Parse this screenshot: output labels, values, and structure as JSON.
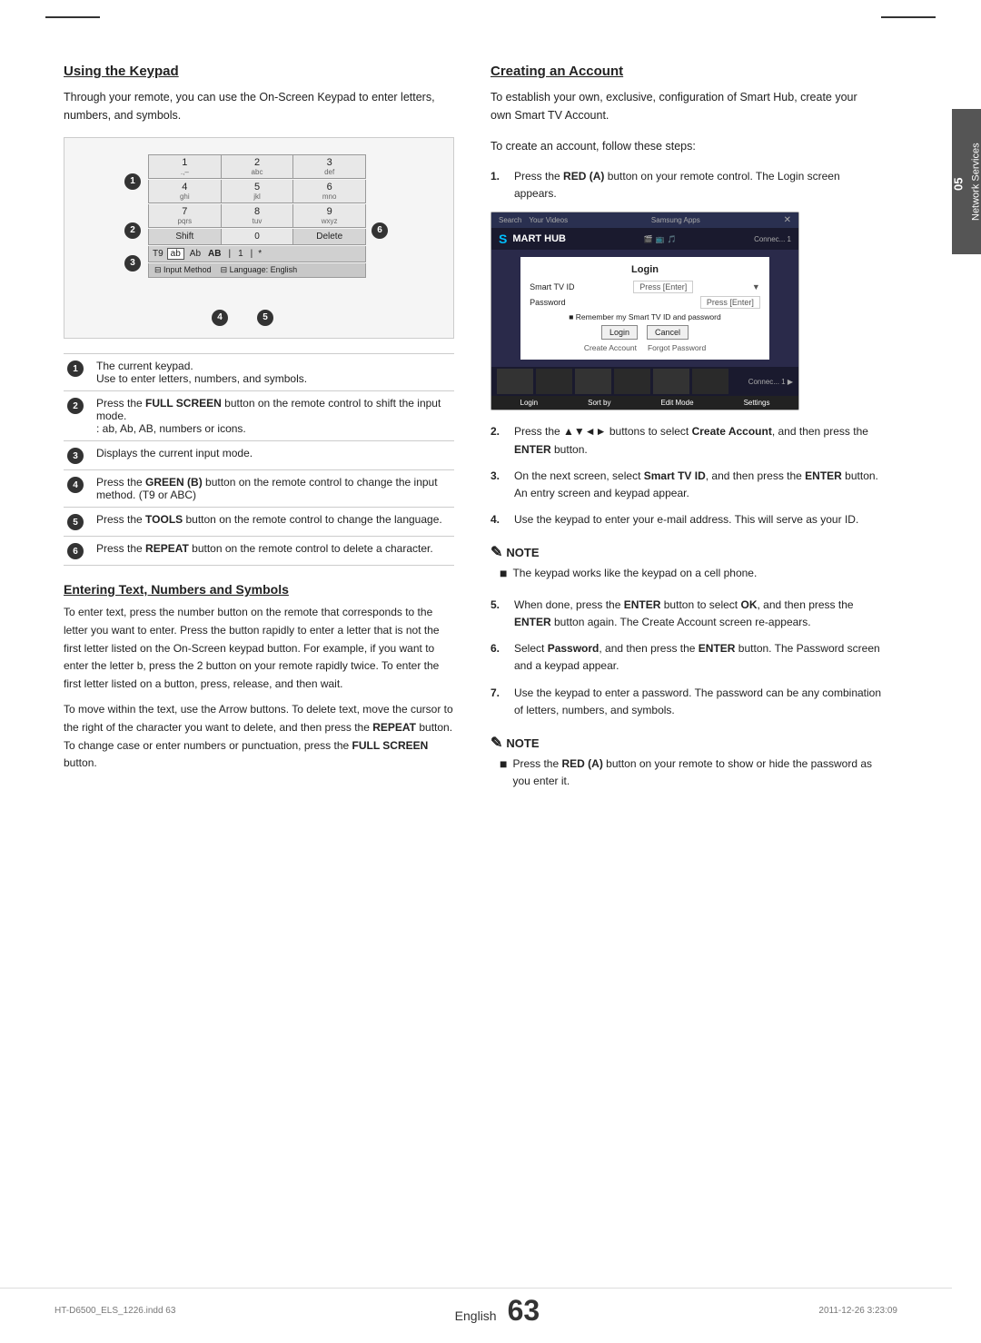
{
  "page": {
    "title": "Network Services",
    "chapter_number": "05",
    "page_number": "63",
    "english_label": "English",
    "footer_left": "HT-D6500_ELS_1226.indd   63",
    "footer_right": "2011-12-26   3:23:09"
  },
  "left": {
    "section_title": "Using the Keypad",
    "intro": "Through your remote, you can use the On-Screen Keypad to enter letters, numbers, and symbols.",
    "keypad": {
      "rows": [
        {
          "num": "1",
          "letters": ".,–"
        },
        {
          "num": "2",
          "letters": "abc"
        },
        {
          "num": "3",
          "letters": "def"
        },
        {
          "num": "4",
          "letters": "ghi"
        },
        {
          "num": "5",
          "letters": "jkl"
        },
        {
          "num": "6",
          "letters": "mno"
        },
        {
          "num": "7",
          "letters": "pqrs"
        },
        {
          "num": "8",
          "letters": "tuv"
        },
        {
          "num": "9",
          "letters": "wxyz"
        }
      ],
      "shift_label": "Shift",
      "zero_label": "0",
      "delete_label": "Delete",
      "t9_label": "T9",
      "ab_label": "ab",
      "Ab_label": "Ab",
      "AB_label": "AB",
      "one_label": "1",
      "asterisk_label": "✱",
      "input_method_label": "⊟ Input Method",
      "language_label": "⊟ Language: English"
    },
    "callout_labels": [
      "1",
      "2",
      "3",
      "4",
      "5",
      "6"
    ],
    "annotations": [
      {
        "num": "1",
        "text": "The current keypad.\nUse to enter letters, numbers, and symbols."
      },
      {
        "num": "2",
        "text_before": "Press the ",
        "bold": "FULL SCREEN",
        "text_after": " button on the remote control to shift the input mode.\n: ab, Ab, AB, numbers or icons."
      },
      {
        "num": "3",
        "text": "Displays the current input mode."
      },
      {
        "num": "4",
        "text_before": "Press the ",
        "bold": "GREEN (B)",
        "text_after": " button on the remote control to change the input method. (T9 or ABC)"
      },
      {
        "num": "5",
        "text_before": "Press the ",
        "bold": "TOOLS",
        "text_after": " button on the remote control to change the language."
      },
      {
        "num": "6",
        "text_before": "Press the ",
        "bold": "REPEAT",
        "text_after": " button on the remote control to delete a character."
      }
    ],
    "entering_title": "Entering Text, Numbers and Symbols",
    "entering_text1": "To enter text, press the number button on the remote that corresponds to the letter you want to enter. Press the button rapidly to enter a letter that is not the first letter listed on the On-Screen keypad button. For example, if you want to enter the letter b, press the 2 button on your remote rapidly twice. To enter the first letter listed on a button, press, release, and then wait.",
    "entering_text2": "To move within the text, use the Arrow buttons. To delete text, move the cursor to the right of the character you want to delete, and then press the ",
    "entering_bold1": "REPEAT",
    "entering_text3": " button. To change case or enter numbers or punctuation, press the ",
    "entering_bold2": "FULL SCREEN",
    "entering_text4": " button."
  },
  "right": {
    "section_title": "Creating an Account",
    "intro_text": "To establish your own, exclusive, configuration of Smart Hub, create your own Smart TV Account.",
    "follow_text": "To create an account, follow these steps:",
    "steps": [
      {
        "num": "1.",
        "text_before": "Press the ",
        "bold1": "RED (A)",
        "text_after": " button on your remote control. The Login screen appears."
      },
      {
        "num": "2.",
        "text_before": "Press the ▲▼◄► buttons to select ",
        "bold1": "Create Account",
        "text_after": ", and then press the ",
        "bold2": "ENTER",
        "text_end": " button."
      },
      {
        "num": "3.",
        "text_before": "On the next screen, select ",
        "bold1": "Smart TV ID",
        "text_after": ", and then press the ",
        "bold2": "ENTER",
        "text_end": " button. An entry screen and keypad appear."
      },
      {
        "num": "4.",
        "text": "Use the keypad to enter your e-mail address. This will serve as your ID."
      }
    ],
    "note1": {
      "header": "NOTE",
      "items": [
        "The keypad works like the keypad on a cell phone."
      ]
    },
    "steps2": [
      {
        "num": "5.",
        "text_before": "When done, press the ",
        "bold1": "ENTER",
        "text_after": " button to select ",
        "bold2": "OK",
        "text_mid": ", and then press the ",
        "bold3": "ENTER",
        "text_end": " button again. The Create Account screen re-appears."
      },
      {
        "num": "6.",
        "text_before": "Select ",
        "bold1": "Password",
        "text_after": ", and then press the ",
        "bold2": "ENTER",
        "text_end": " button. The Password screen and a keypad appear."
      },
      {
        "num": "7.",
        "text": "Use the keypad to enter a password. The password can be any combination of letters, numbers, and symbols."
      }
    ],
    "note2": {
      "header": "NOTE",
      "items": [
        "Press the RED (A) button on your remote to show or hide the password as you enter it."
      ]
    },
    "note2_bold": "RED (A)",
    "login_screen": {
      "top_bar_items": [
        "Your Videos",
        "Samsung Apps"
      ],
      "smart_hub_label": "SMART HUB",
      "s_letter": "S",
      "login_title": "Login",
      "field1_label": "Smart TV ID",
      "field1_value": "Press [Enter]",
      "field2_label": "Password",
      "field2_value": "Press [Enter]",
      "remember_text": "■ Remember my Smart TV ID and password",
      "login_btn": "Login",
      "cancel_btn": "Cancel",
      "create_account_link": "Create Account",
      "forgot_password_link": "Forgot Password",
      "bottom_buttons": [
        "Login",
        "Sort by",
        "Edit Mode",
        "Settings"
      ]
    }
  }
}
